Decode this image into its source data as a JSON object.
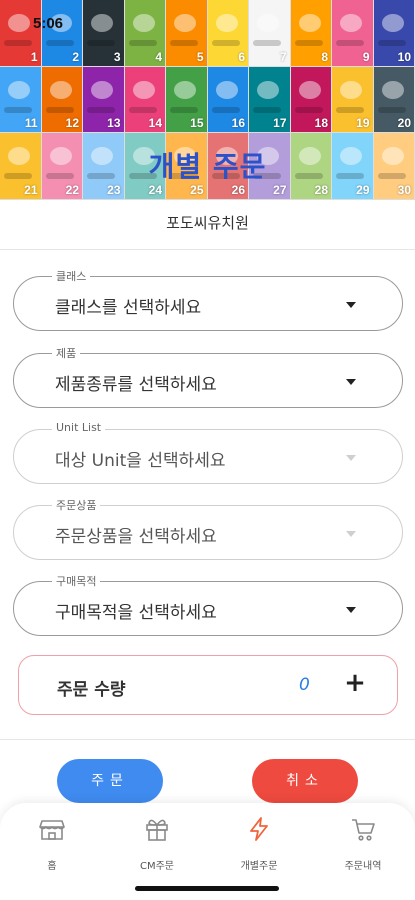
{
  "status_bar": {
    "time": "5:06"
  },
  "banner": {
    "title": "개별 주문",
    "covers": [
      {
        "num": "1",
        "color": "#e53935"
      },
      {
        "num": "2",
        "color": "#1e88e5"
      },
      {
        "num": "3",
        "color": "#263238"
      },
      {
        "num": "4",
        "color": "#7cb342"
      },
      {
        "num": "5",
        "color": "#fb8c00"
      },
      {
        "num": "6",
        "color": "#fdd835"
      },
      {
        "num": "7",
        "color": "#f5f5f5"
      },
      {
        "num": "8",
        "color": "#ffa000"
      },
      {
        "num": "9",
        "color": "#f06292"
      },
      {
        "num": "10",
        "color": "#3949ab"
      },
      {
        "num": "11",
        "color": "#42a5f5"
      },
      {
        "num": "12",
        "color": "#ef6c00"
      },
      {
        "num": "13",
        "color": "#8e24aa"
      },
      {
        "num": "14",
        "color": "#ec407a"
      },
      {
        "num": "15",
        "color": "#43a047"
      },
      {
        "num": "16",
        "color": "#1e88e5"
      },
      {
        "num": "17",
        "color": "#00838f"
      },
      {
        "num": "18",
        "color": "#c2185b"
      },
      {
        "num": "19",
        "color": "#fbc02d"
      },
      {
        "num": "20",
        "color": "#455a64"
      },
      {
        "num": "21",
        "color": "#fbc02d"
      },
      {
        "num": "22",
        "color": "#f48fb1"
      },
      {
        "num": "23",
        "color": "#90caf9"
      },
      {
        "num": "24",
        "color": "#80cbc4"
      },
      {
        "num": "25",
        "color": "#ffb74d"
      },
      {
        "num": "26",
        "color": "#e57373"
      },
      {
        "num": "27",
        "color": "#b39ddb"
      },
      {
        "num": "28",
        "color": "#aed581"
      },
      {
        "num": "29",
        "color": "#81d4fa"
      },
      {
        "num": "30",
        "color": "#ffcc80"
      }
    ]
  },
  "org_name": "포도씨유치원",
  "fields": [
    {
      "legend": "클래스",
      "value": "클래스를 선택하세요",
      "enabled": true
    },
    {
      "legend": "제품",
      "value": "제품종류를 선택하세요",
      "enabled": true
    },
    {
      "legend": "Unit List",
      "value": "대상 Unit을 선택하세요",
      "enabled": false
    },
    {
      "legend": "주문상품",
      "value": "주문상품을 선택하세요",
      "enabled": false
    },
    {
      "legend": "구매목적",
      "value": "구매목적을 선택하세요",
      "enabled": true
    }
  ],
  "quantity": {
    "label": "주문 수량",
    "value": "0",
    "plus": "+"
  },
  "buttons": {
    "order": "주문",
    "cancel": "취소"
  },
  "colors": {
    "title_blue": "#2b52c9",
    "order_blue": "#3f8bf0",
    "cancel_red": "#ee4a3f",
    "active_tab": "#f0643c"
  },
  "tabs": [
    {
      "label": "홈",
      "icon": "store-icon"
    },
    {
      "label": "CM주문",
      "icon": "gift-icon"
    },
    {
      "label": "개별주문",
      "icon": "bolt-icon",
      "active": true
    },
    {
      "label": "주문내역",
      "icon": "cart-icon"
    }
  ]
}
